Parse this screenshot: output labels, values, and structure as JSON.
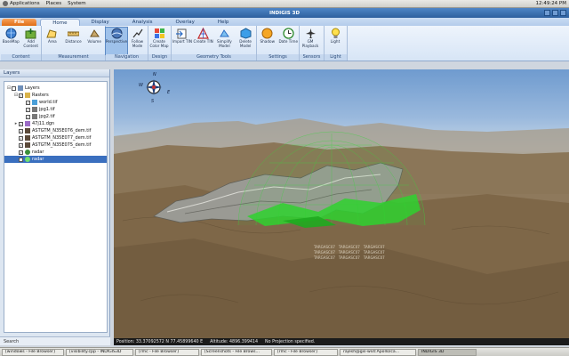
{
  "gnome_panel": {
    "menus": [
      "Applications",
      "Places",
      "System"
    ],
    "clock": "12:49:24 PM"
  },
  "window": {
    "title": "INDIGIS 3D"
  },
  "ribbon": {
    "tabs": [
      "File",
      "Home",
      "Display",
      "Analysis",
      "Overlay",
      "Help"
    ],
    "active_tab": "Home",
    "groups": [
      {
        "label": "Content",
        "buttons": [
          "BaseMap",
          "Add Content"
        ]
      },
      {
        "label": "Measurement",
        "buttons": [
          "Area",
          "Distance",
          "Volume"
        ]
      },
      {
        "label": "Navigation",
        "buttons": [
          "Perspective",
          "Follow Mode"
        ]
      },
      {
        "label": "Design",
        "buttons": [
          "Create Color Map"
        ]
      },
      {
        "label": "Geometry Tools",
        "buttons": [
          "Import TIN",
          "Create TIN",
          "Simplify Model",
          "Delete Model"
        ]
      },
      {
        "label": "Settings",
        "buttons": [
          "Shadow",
          "Date Time"
        ]
      },
      {
        "label": "Sensors",
        "buttons": [
          "GM Playback"
        ]
      },
      {
        "label": "Light",
        "buttons": [
          "Light"
        ]
      }
    ]
  },
  "layers_panel": {
    "title": "Layers",
    "nodes": [
      "Layers",
      "Rasters",
      "world.tif",
      "jpg1.tif",
      "jpg2.tif",
      "47j11.dgn",
      "ASTGTM_N35E076_dem.tif",
      "ASTGTM_N35E077_dem.tif",
      "ASTGTM_N35E075_dem.tif",
      "radar",
      "radar"
    ],
    "search_label": "Search"
  },
  "view": {
    "compass": {
      "n": "N",
      "s": "S",
      "e": "E",
      "w": "W"
    },
    "labels": [
      "TARGASC07",
      "TARGASC07",
      "TARGASC07",
      "TARGASC07",
      "TARGASC07",
      "TARGASC07",
      "TARGASC07",
      "TARGASC07",
      "TARGASC07"
    ]
  },
  "status": {
    "position": "Position: 33.37092572 N  77.45899640 E",
    "altitude": "Altitude: 4896.399414",
    "projection": "No Projection specified."
  },
  "taskbar": [
    "[windows - File Browser]",
    "[visibility.cpp - INDIGIS3D",
    "[rmc - File Browser]",
    "[Screenshots - File Brows...",
    "[rmc - File Browser]",
    "rajesh@gis-ws4:Apollo/ca...",
    "INDIGIS 3D"
  ],
  "colors": {
    "ribbon_bg": "#eef4fc",
    "title_bar": "#2d5f9e",
    "file_tab": "#e06d16",
    "radar_dome": "#39d43c",
    "selection": "#3a6fbf"
  }
}
